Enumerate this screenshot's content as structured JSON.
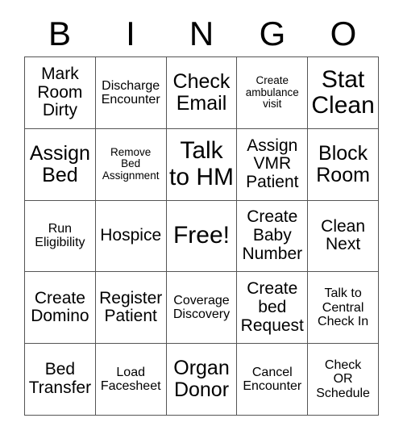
{
  "card": {
    "title": "BINGO",
    "header_letters": [
      "B",
      "I",
      "N",
      "G",
      "O"
    ],
    "free_space_label": "Free!",
    "colors": {
      "background": "#ffffff",
      "text": "#000000",
      "grid_line": "#555555"
    },
    "grid_size": "5x5",
    "rows": [
      [
        {
          "text": "Mark\nRoom\nDirty",
          "size": "md"
        },
        {
          "text": "Discharge\nEncounter",
          "size": "sm"
        },
        {
          "text": "Check\nEmail",
          "size": "lg"
        },
        {
          "text": "Create\nambulance\nvisit",
          "size": "xs"
        },
        {
          "text": "Stat\nClean",
          "size": "xl"
        }
      ],
      [
        {
          "text": "Assign\nBed",
          "size": "lg"
        },
        {
          "text": "Remove\nBed\nAssignment",
          "size": "xs"
        },
        {
          "text": "Talk\nto HM",
          "size": "xl"
        },
        {
          "text": "Assign\nVMR\nPatient",
          "size": "md"
        },
        {
          "text": "Block\nRoom",
          "size": "lg"
        }
      ],
      [
        {
          "text": "Run\nEligibility",
          "size": "sm"
        },
        {
          "text": "Hospice",
          "size": "md"
        },
        {
          "text": "Free!",
          "size": "xl"
        },
        {
          "text": "Create\nBaby\nNumber",
          "size": "md"
        },
        {
          "text": "Clean\nNext",
          "size": "md"
        }
      ],
      [
        {
          "text": "Create\nDomino",
          "size": "md"
        },
        {
          "text": "Register\nPatient",
          "size": "md"
        },
        {
          "text": "Coverage\nDiscovery",
          "size": "sm"
        },
        {
          "text": "Create\nbed\nRequest",
          "size": "md"
        },
        {
          "text": "Talk to\nCentral\nCheck In",
          "size": "sm"
        }
      ],
      [
        {
          "text": "Bed\nTransfer",
          "size": "md"
        },
        {
          "text": "Load\nFacesheet",
          "size": "sm"
        },
        {
          "text": "Organ\nDonor",
          "size": "lg"
        },
        {
          "text": "Cancel\nEncounter",
          "size": "sm"
        },
        {
          "text": "Check\nOR\nSchedule",
          "size": "sm"
        }
      ]
    ]
  }
}
